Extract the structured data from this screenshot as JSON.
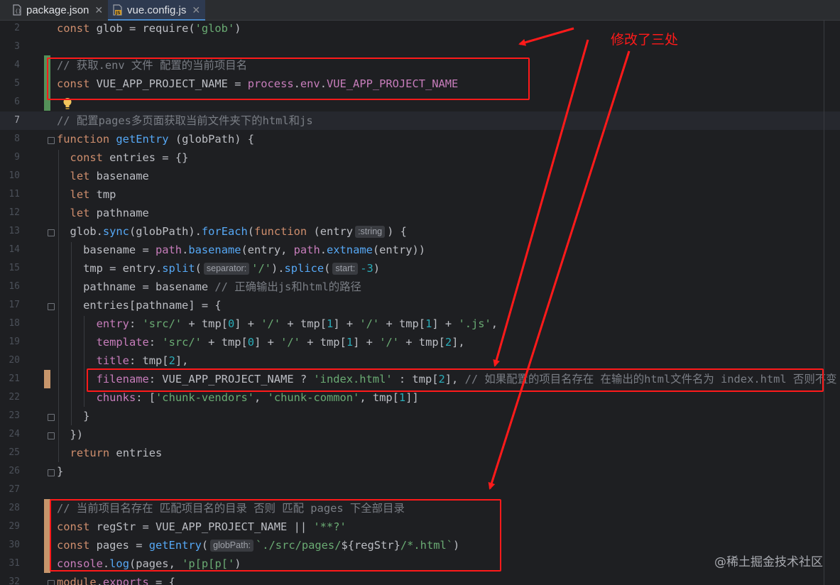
{
  "tabs": [
    {
      "label": "package.json",
      "icon": "json-file-icon",
      "active": false
    },
    {
      "label": "vue.config.js",
      "icon": "js-file-icon",
      "active": true
    }
  ],
  "lines": [
    {
      "n": "2",
      "tokens": [
        [
          "kw",
          "const "
        ],
        [
          "",
          "glob = require("
        ],
        [
          "str",
          "'glob'"
        ],
        [
          "",
          ")"
        ]
      ]
    },
    {
      "n": "3",
      "tokens": []
    },
    {
      "n": "4",
      "tokens": [
        [
          "cm",
          "// 获取.env 文件 配置的当前项目名"
        ]
      ]
    },
    {
      "n": "5",
      "tokens": [
        [
          "kw",
          "const "
        ],
        [
          "",
          "VUE_APP_PROJECT_NAME = "
        ],
        [
          "prop",
          "process"
        ],
        [
          "",
          "."
        ],
        [
          "prop",
          "env"
        ],
        [
          "",
          "."
        ],
        [
          "prop",
          "VUE_APP_PROJECT_NAME"
        ]
      ]
    },
    {
      "n": "6",
      "tokens": []
    },
    {
      "n": "7",
      "tokens": [
        [
          "cm",
          "// 配置pages多页面获取当前文件夹下的html和js"
        ]
      ]
    },
    {
      "n": "8",
      "tokens": [
        [
          "kw",
          "function "
        ],
        [
          "fn",
          "getEntry"
        ],
        [
          "",
          " (globPath) {"
        ]
      ]
    },
    {
      "n": "9",
      "tokens": [
        [
          "",
          "  "
        ],
        [
          "kw",
          "const "
        ],
        [
          "",
          "entries = {}"
        ]
      ]
    },
    {
      "n": "10",
      "tokens": [
        [
          "",
          "  "
        ],
        [
          "kw",
          "let "
        ],
        [
          "",
          "basename"
        ]
      ]
    },
    {
      "n": "11",
      "tokens": [
        [
          "",
          "  "
        ],
        [
          "kw",
          "let "
        ],
        [
          "",
          "tmp"
        ]
      ]
    },
    {
      "n": "12",
      "tokens": [
        [
          "",
          "  "
        ],
        [
          "kw",
          "let "
        ],
        [
          "",
          "pathname"
        ]
      ]
    },
    {
      "n": "13",
      "tokens": [
        [
          "",
          "  glob."
        ],
        [
          "fn",
          "sync"
        ],
        [
          "",
          "(globPath)."
        ],
        [
          "fn",
          "forEach"
        ],
        [
          "",
          "("
        ],
        [
          "kw",
          "function "
        ],
        [
          "",
          "(entry"
        ],
        [
          "hint",
          ":string"
        ],
        [
          "",
          ") {"
        ]
      ]
    },
    {
      "n": "14",
      "tokens": [
        [
          "",
          "    basename = "
        ],
        [
          "prop",
          "path"
        ],
        [
          "",
          "."
        ],
        [
          "fn",
          "basename"
        ],
        [
          "",
          "(entry, "
        ],
        [
          "prop",
          "path"
        ],
        [
          "",
          "."
        ],
        [
          "fn",
          "extname"
        ],
        [
          "",
          "(entry))"
        ]
      ]
    },
    {
      "n": "15",
      "tokens": [
        [
          "",
          "    tmp = entry."
        ],
        [
          "fn",
          "split"
        ],
        [
          "",
          "("
        ],
        [
          "hint",
          "separator:"
        ],
        [
          "str",
          "'/'"
        ],
        [
          "",
          ")."
        ],
        [
          "fn",
          "splice"
        ],
        [
          "",
          "("
        ],
        [
          "hint",
          "start:"
        ],
        [
          "num",
          "-3"
        ],
        [
          "",
          ")"
        ]
      ]
    },
    {
      "n": "16",
      "tokens": [
        [
          "",
          "    pathname = basename "
        ],
        [
          "cm",
          "// 正确输出js和html的路径"
        ]
      ]
    },
    {
      "n": "17",
      "tokens": [
        [
          "",
          "    entries[pathname] = {"
        ]
      ]
    },
    {
      "n": "18",
      "tokens": [
        [
          "",
          "      "
        ],
        [
          "prop",
          "entry"
        ],
        [
          "",
          ": "
        ],
        [
          "str",
          "'src/'"
        ],
        [
          "",
          " + tmp["
        ],
        [
          "num",
          "0"
        ],
        [
          "",
          "] + "
        ],
        [
          "str",
          "'/'"
        ],
        [
          "",
          " + tmp["
        ],
        [
          "num",
          "1"
        ],
        [
          "",
          "] + "
        ],
        [
          "str",
          "'/'"
        ],
        [
          "",
          " + tmp["
        ],
        [
          "num",
          "1"
        ],
        [
          "",
          "] + "
        ],
        [
          "str",
          "'.js'"
        ],
        [
          "",
          ","
        ]
      ]
    },
    {
      "n": "19",
      "tokens": [
        [
          "",
          "      "
        ],
        [
          "prop",
          "template"
        ],
        [
          "",
          ": "
        ],
        [
          "str",
          "'src/'"
        ],
        [
          "",
          " + tmp["
        ],
        [
          "num",
          "0"
        ],
        [
          "",
          "] + "
        ],
        [
          "str",
          "'/'"
        ],
        [
          "",
          " + tmp["
        ],
        [
          "num",
          "1"
        ],
        [
          "",
          "] + "
        ],
        [
          "str",
          "'/'"
        ],
        [
          "",
          " + tmp["
        ],
        [
          "num",
          "2"
        ],
        [
          "",
          "],"
        ]
      ]
    },
    {
      "n": "20",
      "tokens": [
        [
          "",
          "      "
        ],
        [
          "prop",
          "title"
        ],
        [
          "",
          ": tmp["
        ],
        [
          "num",
          "2"
        ],
        [
          "",
          "],"
        ]
      ]
    },
    {
      "n": "21",
      "tokens": [
        [
          "",
          "      "
        ],
        [
          "prop",
          "filename"
        ],
        [
          "",
          ": VUE_APP_PROJECT_NAME ? "
        ],
        [
          "str",
          "'index.html'"
        ],
        [
          "",
          " : tmp["
        ],
        [
          "num",
          "2"
        ],
        [
          "",
          "], "
        ],
        [
          "cm",
          "// 如果配置的项目名存在 在输出的html文件名为 index.html 否则不变"
        ]
      ]
    },
    {
      "n": "22",
      "tokens": [
        [
          "",
          "      "
        ],
        [
          "prop",
          "chunks"
        ],
        [
          "",
          ": ["
        ],
        [
          "str",
          "'chunk-vendors'"
        ],
        [
          "",
          ", "
        ],
        [
          "str",
          "'chunk-common'"
        ],
        [
          "",
          ", tmp["
        ],
        [
          "num",
          "1"
        ],
        [
          "",
          "]]"
        ]
      ]
    },
    {
      "n": "23",
      "tokens": [
        [
          "",
          "    }"
        ]
      ]
    },
    {
      "n": "24",
      "tokens": [
        [
          "",
          "  })"
        ]
      ]
    },
    {
      "n": "25",
      "tokens": [
        [
          "",
          "  "
        ],
        [
          "kw",
          "return "
        ],
        [
          "",
          "entries"
        ]
      ]
    },
    {
      "n": "26",
      "tokens": [
        [
          "",
          "}"
        ]
      ]
    },
    {
      "n": "27",
      "tokens": []
    },
    {
      "n": "28",
      "tokens": [
        [
          "cm",
          "// 当前项目名存在 匹配项目名的目录 否则 匹配 pages 下全部目录"
        ]
      ]
    },
    {
      "n": "29",
      "tokens": [
        [
          "kw",
          "const "
        ],
        [
          "",
          "regStr = VUE_APP_PROJECT_NAME || "
        ],
        [
          "str",
          "'**?'"
        ]
      ]
    },
    {
      "n": "30",
      "tokens": [
        [
          "kw",
          "const "
        ],
        [
          "",
          "pages = "
        ],
        [
          "fn",
          "getEntry"
        ],
        [
          "",
          "("
        ],
        [
          "hint",
          "globPath:"
        ],
        [
          "str",
          "`./src/pages/"
        ],
        [
          "",
          "${regStr}"
        ],
        [
          "str",
          "/*.html`"
        ],
        [
          "",
          ")"
        ]
      ]
    },
    {
      "n": "31",
      "tokens": [
        [
          "prop",
          "console"
        ],
        [
          "",
          "."
        ],
        [
          "fn",
          "log"
        ],
        [
          "",
          "(pages, "
        ],
        [
          "str",
          "'p[p[p['"
        ],
        [
          "",
          ")"
        ]
      ]
    },
    {
      "n": "32",
      "tokens": [
        [
          "kw",
          "module"
        ],
        [
          "",
          "."
        ],
        [
          "prop",
          "exports"
        ],
        [
          "",
          " = {"
        ]
      ]
    }
  ],
  "current_line": "7",
  "annotation": "修改了三处",
  "watermark": "@稀土掘金技术社区",
  "colors": {
    "annotation_red": "#ff1a1a",
    "background": "#1e1f22",
    "keyword": "#cf8e6d",
    "function": "#56a8f5",
    "string": "#6aab73",
    "comment": "#7a7e85"
  }
}
